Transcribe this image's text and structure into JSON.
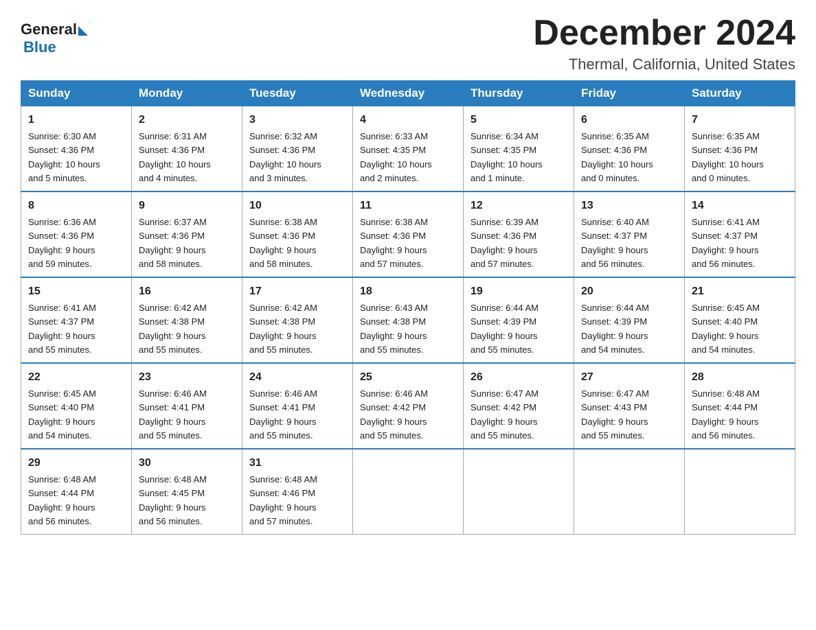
{
  "header": {
    "logo_general": "General",
    "logo_blue": "Blue",
    "month_title": "December 2024",
    "location": "Thermal, California, United States"
  },
  "weekdays": [
    "Sunday",
    "Monday",
    "Tuesday",
    "Wednesday",
    "Thursday",
    "Friday",
    "Saturday"
  ],
  "weeks": [
    [
      {
        "day": "1",
        "sunrise": "6:30 AM",
        "sunset": "4:36 PM",
        "daylight": "10 hours and 5 minutes."
      },
      {
        "day": "2",
        "sunrise": "6:31 AM",
        "sunset": "4:36 PM",
        "daylight": "10 hours and 4 minutes."
      },
      {
        "day": "3",
        "sunrise": "6:32 AM",
        "sunset": "4:36 PM",
        "daylight": "10 hours and 3 minutes."
      },
      {
        "day": "4",
        "sunrise": "6:33 AM",
        "sunset": "4:35 PM",
        "daylight": "10 hours and 2 minutes."
      },
      {
        "day": "5",
        "sunrise": "6:34 AM",
        "sunset": "4:35 PM",
        "daylight": "10 hours and 1 minute."
      },
      {
        "day": "6",
        "sunrise": "6:35 AM",
        "sunset": "4:36 PM",
        "daylight": "10 hours and 0 minutes."
      },
      {
        "day": "7",
        "sunrise": "6:35 AM",
        "sunset": "4:36 PM",
        "daylight": "10 hours and 0 minutes."
      }
    ],
    [
      {
        "day": "8",
        "sunrise": "6:36 AM",
        "sunset": "4:36 PM",
        "daylight": "9 hours and 59 minutes."
      },
      {
        "day": "9",
        "sunrise": "6:37 AM",
        "sunset": "4:36 PM",
        "daylight": "9 hours and 58 minutes."
      },
      {
        "day": "10",
        "sunrise": "6:38 AM",
        "sunset": "4:36 PM",
        "daylight": "9 hours and 58 minutes."
      },
      {
        "day": "11",
        "sunrise": "6:38 AM",
        "sunset": "4:36 PM",
        "daylight": "9 hours and 57 minutes."
      },
      {
        "day": "12",
        "sunrise": "6:39 AM",
        "sunset": "4:36 PM",
        "daylight": "9 hours and 57 minutes."
      },
      {
        "day": "13",
        "sunrise": "6:40 AM",
        "sunset": "4:37 PM",
        "daylight": "9 hours and 56 minutes."
      },
      {
        "day": "14",
        "sunrise": "6:41 AM",
        "sunset": "4:37 PM",
        "daylight": "9 hours and 56 minutes."
      }
    ],
    [
      {
        "day": "15",
        "sunrise": "6:41 AM",
        "sunset": "4:37 PM",
        "daylight": "9 hours and 55 minutes."
      },
      {
        "day": "16",
        "sunrise": "6:42 AM",
        "sunset": "4:38 PM",
        "daylight": "9 hours and 55 minutes."
      },
      {
        "day": "17",
        "sunrise": "6:42 AM",
        "sunset": "4:38 PM",
        "daylight": "9 hours and 55 minutes."
      },
      {
        "day": "18",
        "sunrise": "6:43 AM",
        "sunset": "4:38 PM",
        "daylight": "9 hours and 55 minutes."
      },
      {
        "day": "19",
        "sunrise": "6:44 AM",
        "sunset": "4:39 PM",
        "daylight": "9 hours and 55 minutes."
      },
      {
        "day": "20",
        "sunrise": "6:44 AM",
        "sunset": "4:39 PM",
        "daylight": "9 hours and 54 minutes."
      },
      {
        "day": "21",
        "sunrise": "6:45 AM",
        "sunset": "4:40 PM",
        "daylight": "9 hours and 54 minutes."
      }
    ],
    [
      {
        "day": "22",
        "sunrise": "6:45 AM",
        "sunset": "4:40 PM",
        "daylight": "9 hours and 54 minutes."
      },
      {
        "day": "23",
        "sunrise": "6:46 AM",
        "sunset": "4:41 PM",
        "daylight": "9 hours and 55 minutes."
      },
      {
        "day": "24",
        "sunrise": "6:46 AM",
        "sunset": "4:41 PM",
        "daylight": "9 hours and 55 minutes."
      },
      {
        "day": "25",
        "sunrise": "6:46 AM",
        "sunset": "4:42 PM",
        "daylight": "9 hours and 55 minutes."
      },
      {
        "day": "26",
        "sunrise": "6:47 AM",
        "sunset": "4:42 PM",
        "daylight": "9 hours and 55 minutes."
      },
      {
        "day": "27",
        "sunrise": "6:47 AM",
        "sunset": "4:43 PM",
        "daylight": "9 hours and 55 minutes."
      },
      {
        "day": "28",
        "sunrise": "6:48 AM",
        "sunset": "4:44 PM",
        "daylight": "9 hours and 56 minutes."
      }
    ],
    [
      {
        "day": "29",
        "sunrise": "6:48 AM",
        "sunset": "4:44 PM",
        "daylight": "9 hours and 56 minutes."
      },
      {
        "day": "30",
        "sunrise": "6:48 AM",
        "sunset": "4:45 PM",
        "daylight": "9 hours and 56 minutes."
      },
      {
        "day": "31",
        "sunrise": "6:48 AM",
        "sunset": "4:46 PM",
        "daylight": "9 hours and 57 minutes."
      },
      null,
      null,
      null,
      null
    ]
  ],
  "labels": {
    "sunrise": "Sunrise:",
    "sunset": "Sunset:",
    "daylight": "Daylight:"
  }
}
